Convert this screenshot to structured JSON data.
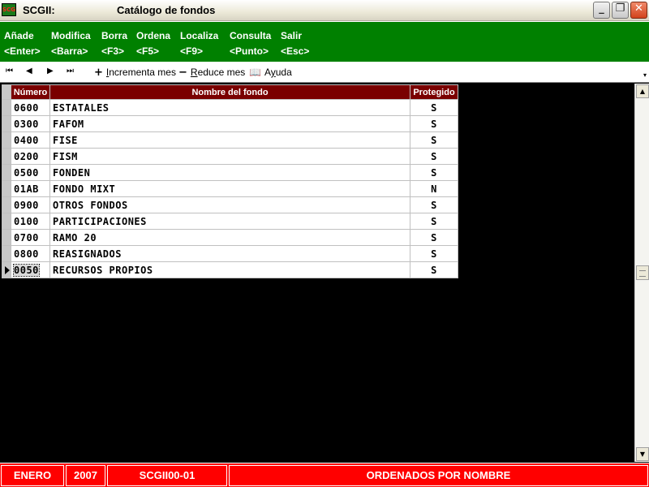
{
  "window": {
    "icon_text": "SCG",
    "app_name": "SCGII:",
    "title": "Catálogo de fondos",
    "controls": {
      "minimize": "_",
      "maximize": "❐",
      "close": "✕"
    }
  },
  "menu": [
    {
      "label": "Añade",
      "key": "<Enter>"
    },
    {
      "label": "Modifica",
      "key": "<Barra>"
    },
    {
      "label": "Borra",
      "key": "<F3>"
    },
    {
      "label": "Ordena",
      "key": "<F5>"
    },
    {
      "label": "Localiza",
      "key": "<F9>"
    },
    {
      "label": "Consulta",
      "key": "<Punto>"
    },
    {
      "label": "Salir",
      "key": "<Esc>"
    }
  ],
  "toolbar": {
    "nav": {
      "first": "⏮",
      "prev": "◀",
      "next": "▶",
      "last": "⏭"
    },
    "incrementa_icon": "+",
    "incrementa_label_u": "I",
    "incrementa_label_rest": "ncrementa mes",
    "reduce_icon": "−",
    "reduce_label_u": "R",
    "reduce_label_rest": "educe mes",
    "ayuda_icon": "📖",
    "ayuda_label_pre": "A",
    "ayuda_label_u": "y",
    "ayuda_label_rest": "uda",
    "dropdown": "▾"
  },
  "grid": {
    "columns": [
      "Número",
      "Nombre del fondo",
      "Protegido"
    ],
    "rows": [
      {
        "numero": "0600",
        "nombre": "ESTATALES",
        "protegido": "S"
      },
      {
        "numero": "0300",
        "nombre": "FAFOM",
        "protegido": "S"
      },
      {
        "numero": "0400",
        "nombre": "FISE",
        "protegido": "S"
      },
      {
        "numero": "0200",
        "nombre": "FISM",
        "protegido": "S"
      },
      {
        "numero": "0500",
        "nombre": "FONDEN",
        "protegido": "S"
      },
      {
        "numero": "01AB",
        "nombre": "FONDO MIXT",
        "protegido": "N"
      },
      {
        "numero": "0900",
        "nombre": "OTROS FONDOS",
        "protegido": "S"
      },
      {
        "numero": "0100",
        "nombre": "PARTICIPACIONES",
        "protegido": "S"
      },
      {
        "numero": "0700",
        "nombre": "RAMO 20",
        "protegido": "S"
      },
      {
        "numero": "0800",
        "nombre": "REASIGNADOS",
        "protegido": "S"
      },
      {
        "numero": "0050",
        "nombre": "RECURSOS PROPIOS",
        "protegido": "S"
      }
    ],
    "selected_row": 10
  },
  "scrollbar": {
    "up": "▲",
    "down": "▼"
  },
  "status": {
    "month": "ENERO",
    "year": "2007",
    "module": "SCGII00-01",
    "message": "ORDENADOS POR NOMBRE"
  },
  "colors": {
    "menu_bg": "#008000",
    "header_bg": "#7a0000",
    "status_bg": "#ff0000"
  }
}
